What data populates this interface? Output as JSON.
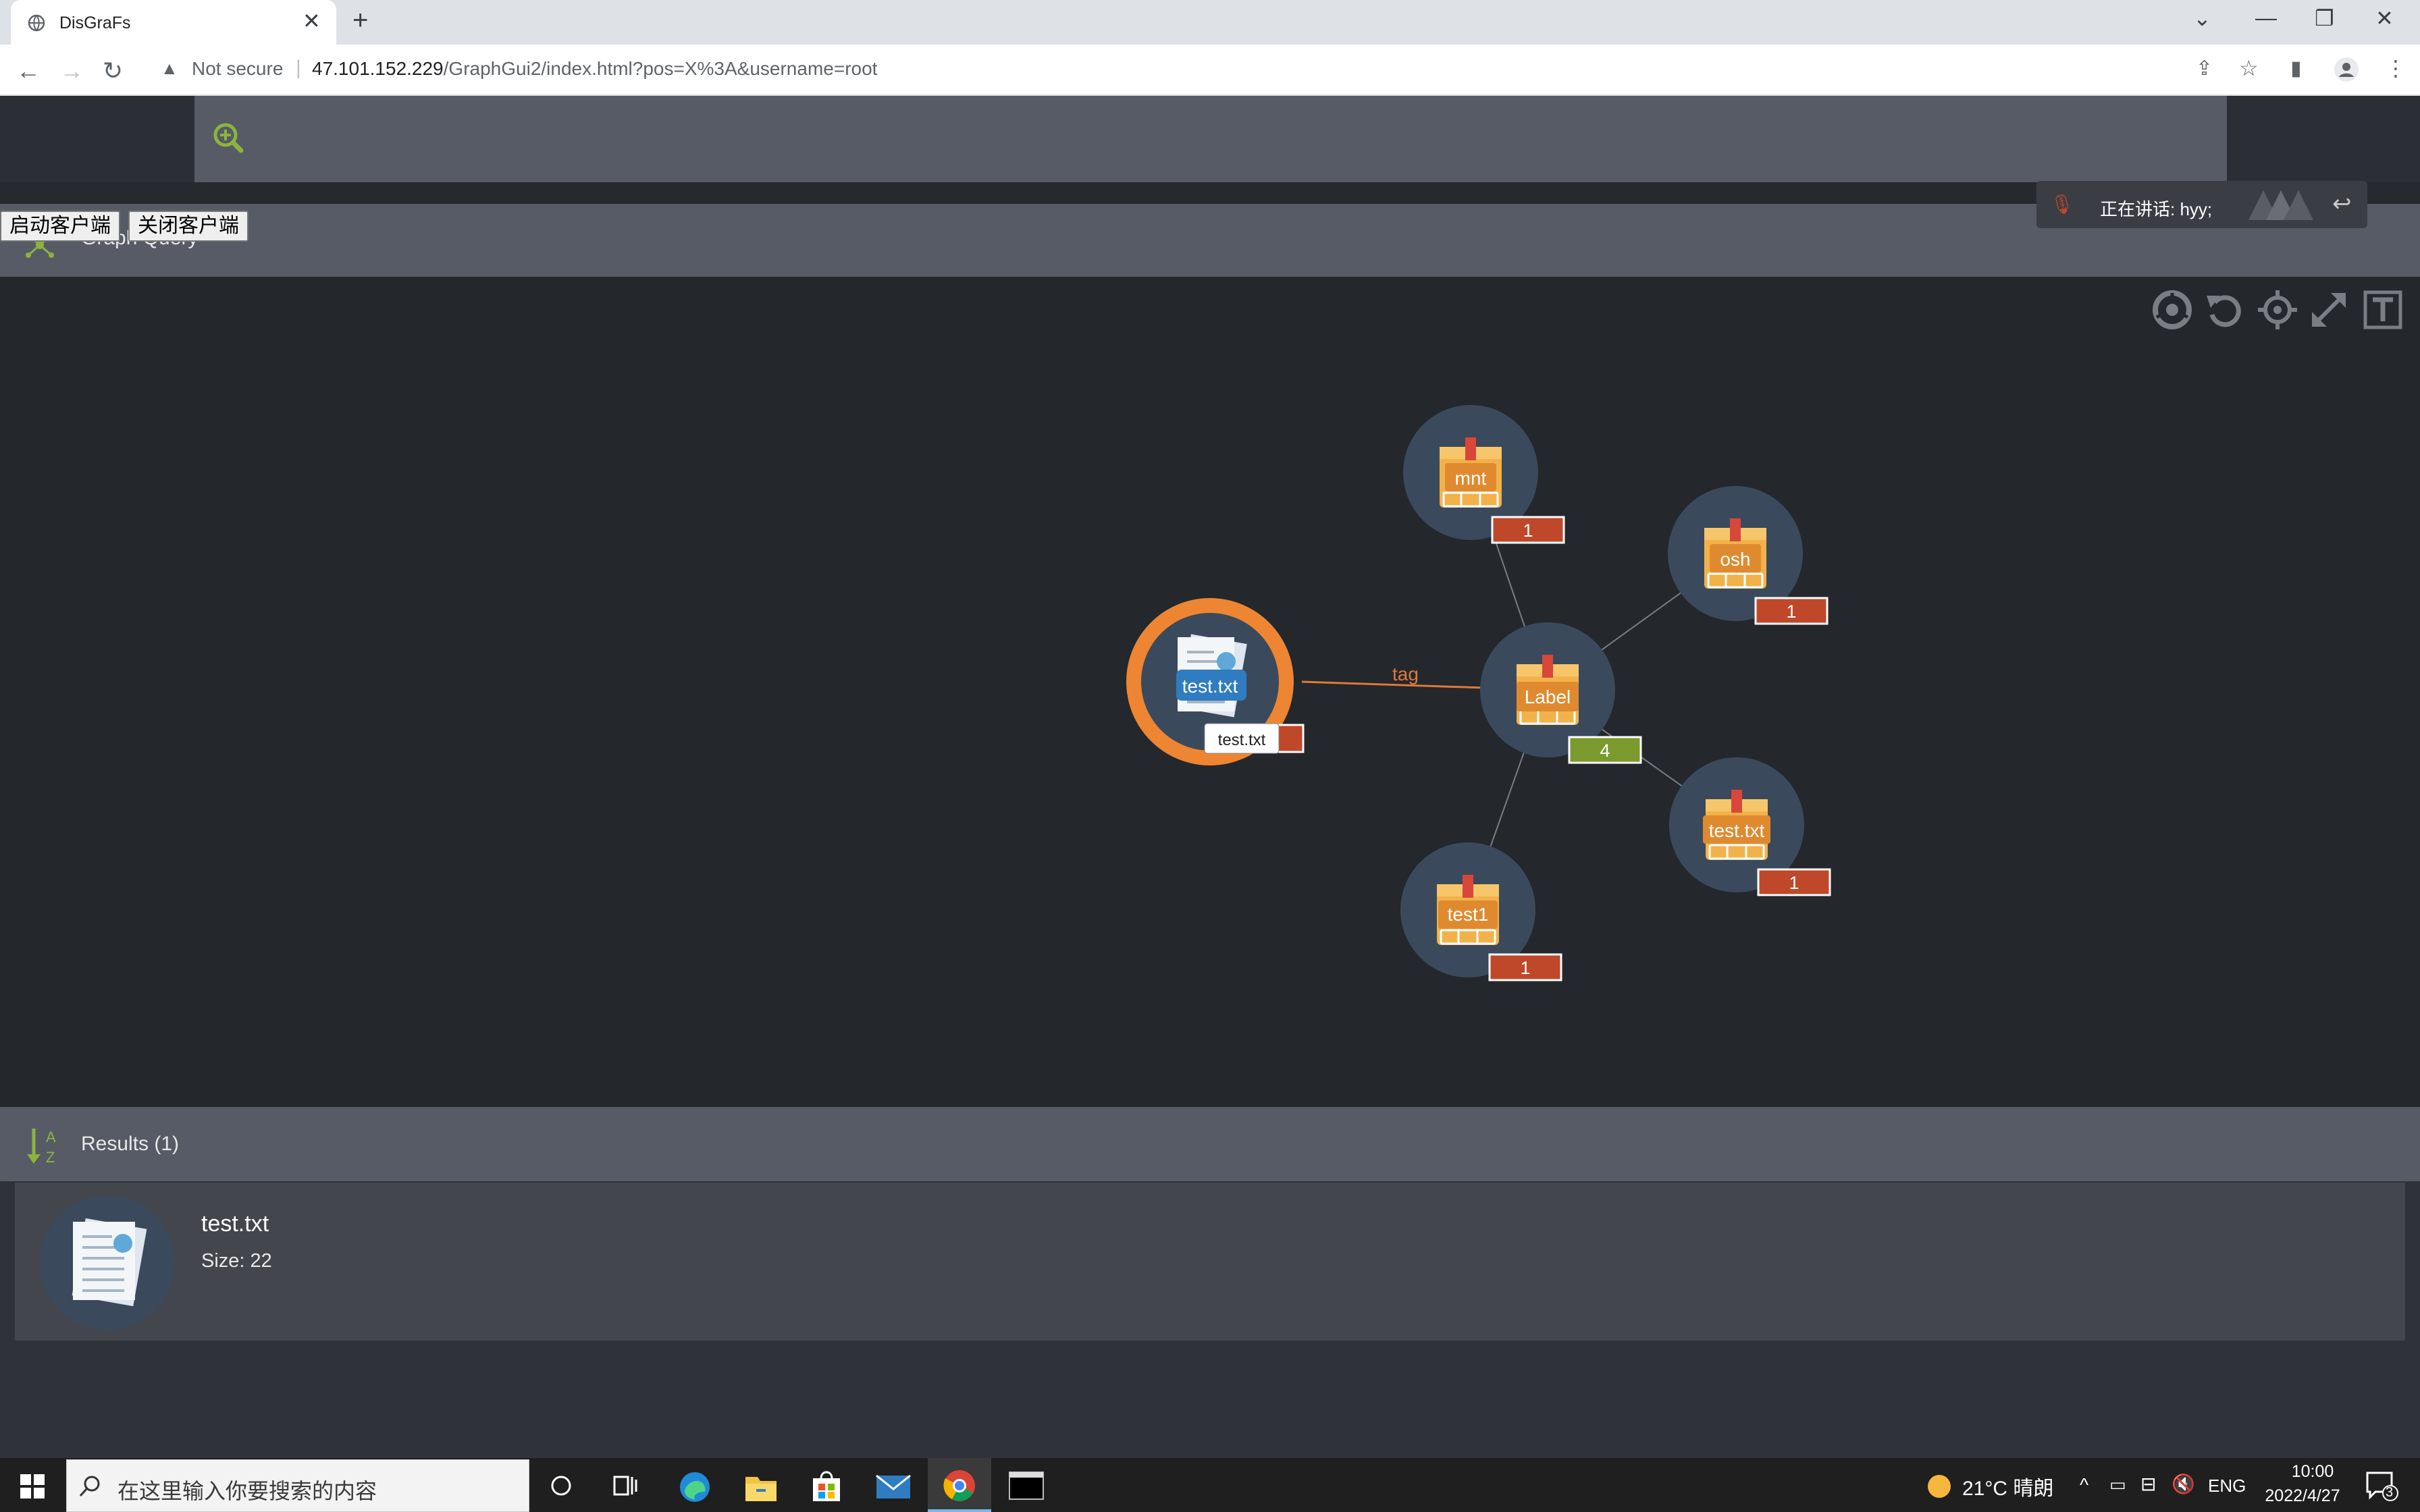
{
  "browser": {
    "tab_title": "DisGraFs",
    "security_label": "Not secure",
    "url_host": "47.101.152.229",
    "url_path": "/GraphGui2/index.html?pos=X%3A&username=root"
  },
  "toolbar": {
    "start_client": "启动客户端",
    "stop_client": "关闭客户端"
  },
  "graph_panel": {
    "title": "Graph Query"
  },
  "voice": {
    "speaking": "正在讲话: hyy;"
  },
  "graph": {
    "center_file": {
      "label": "test.txt",
      "tooltip": "test.txt"
    },
    "edge_label": "tag",
    "hub": {
      "label": "Label",
      "count": "4"
    },
    "tags": [
      {
        "label": "mnt",
        "count": "1"
      },
      {
        "label": "osh",
        "count": "1"
      },
      {
        "label": "test.txt",
        "count": "1"
      },
      {
        "label": "test1",
        "count": "1"
      }
    ]
  },
  "results": {
    "title": "Results (1)",
    "items": [
      {
        "name": "test.txt",
        "size": "Size: 22"
      }
    ]
  },
  "taskbar": {
    "search_placeholder": "在这里输入你要搜索的内容",
    "weather": "21°C  晴朗",
    "lang": "ENG",
    "time": "10:00",
    "date": "2022/4/27",
    "notifications": "3"
  },
  "colors": {
    "accent_green": "#8cb43c",
    "orange_ring": "#ee8532",
    "count_badge": "#c0482a",
    "hub_badge": "#7a9a2e",
    "node_bg": "#3a4a5c"
  }
}
